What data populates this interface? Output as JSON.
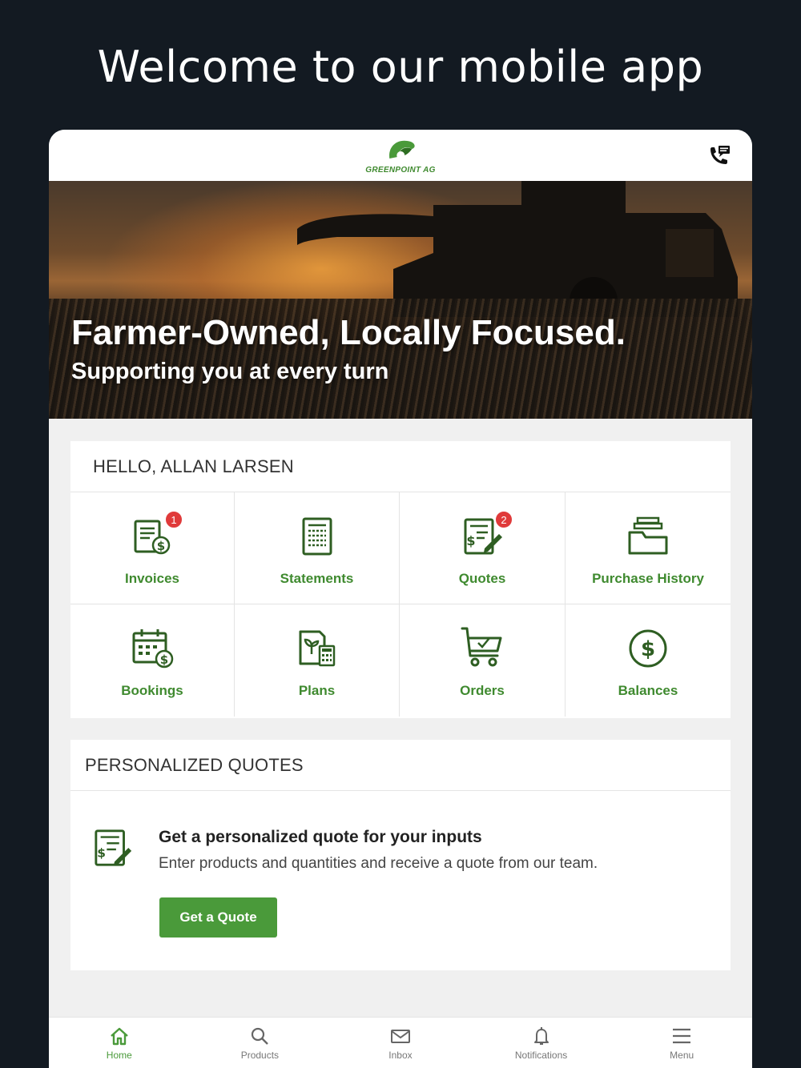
{
  "promo": {
    "title": "Welcome to our mobile app"
  },
  "header": {
    "logo_text": "GREENPOINT AG"
  },
  "hero": {
    "headline": "Farmer-Owned, Locally Focused.",
    "subhead": "Supporting you at every turn"
  },
  "dashboard": {
    "greeting": "HELLO, ALLAN LARSEN",
    "tiles": [
      {
        "label": "Invoices",
        "icon": "invoice-icon",
        "badge": "1"
      },
      {
        "label": "Statements",
        "icon": "statement-icon",
        "badge": null
      },
      {
        "label": "Quotes",
        "icon": "quote-icon",
        "badge": "2"
      },
      {
        "label": "Purchase History",
        "icon": "purchase-history-icon",
        "badge": null
      },
      {
        "label": "Bookings",
        "icon": "bookings-calendar-icon",
        "badge": null
      },
      {
        "label": "Plans",
        "icon": "plans-icon",
        "badge": null
      },
      {
        "label": "Orders",
        "icon": "cart-icon",
        "badge": null
      },
      {
        "label": "Balances",
        "icon": "dollar-circle-icon",
        "badge": null
      }
    ]
  },
  "quotes": {
    "title": "PERSONALIZED QUOTES",
    "heading": "Get a personalized quote for your inputs",
    "description": "Enter products and quantities and receive a quote from our team.",
    "button_label": "Get a Quote"
  },
  "nav": {
    "items": [
      {
        "label": "Home",
        "icon": "home-icon",
        "active": true
      },
      {
        "label": "Products",
        "icon": "search-icon",
        "active": false
      },
      {
        "label": "Inbox",
        "icon": "mail-icon",
        "active": false
      },
      {
        "label": "Notifications",
        "icon": "bell-icon",
        "active": false
      },
      {
        "label": "Menu",
        "icon": "hamburger-menu-icon",
        "active": false
      }
    ]
  },
  "colors": {
    "brand_green": "#3f8a2f",
    "button_green": "#4a9a3a",
    "badge_red": "#e03a3a",
    "page_bg": "#131a22"
  }
}
